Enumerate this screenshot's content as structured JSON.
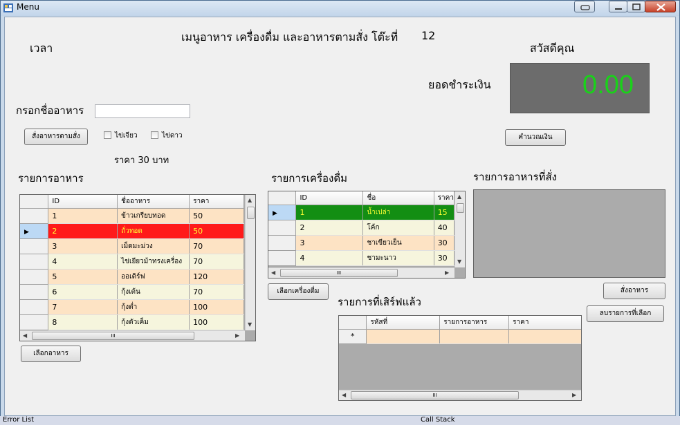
{
  "window": {
    "title": "Menu",
    "controls": [
      "minimize",
      "maximize",
      "close"
    ]
  },
  "labels": {
    "time": "เวลา",
    "header": "เมนูอาหาร เครื่องดื่ม และอาหารตามสั่ง โต๊ะที่",
    "table_number": "12",
    "greeting": "สวัสดีคุณ",
    "total_label": "ยอดชำระเงิน",
    "total_value": "0.00",
    "food_name_label": "กรอกชื่ออาหาร",
    "price_note": "ราคา 30 บาท",
    "food_list_title": "รายการอาหาร",
    "drink_list_title": "รายการเครื่องดื่ม",
    "ordered_list_title": "รายการอาหารที่สั่ง",
    "served_list_title": "รายการที่เสิร์ฟแล้ว"
  },
  "inputs": {
    "food_name_value": ""
  },
  "checkboxes": [
    {
      "label": "ไข่เจียว",
      "checked": false
    },
    {
      "label": "ไข่ดาว",
      "checked": false
    }
  ],
  "buttons": {
    "order_custom": "สั่งอาหารตามสั่ง",
    "calculate": "คำนวณเงิน",
    "select_food": "เลือกอาหาร",
    "select_drink": "เลือกเครื่องดื่ม",
    "place_order": "สั่งอาหาร",
    "delete_selected": "ลบรายการที่เลือก"
  },
  "food_grid": {
    "columns": [
      "ID",
      "ชื่ออาหาร",
      "ราคา"
    ],
    "rows": [
      {
        "id": "1",
        "name": "ข้าวเกรียบทอด",
        "price": "50"
      },
      {
        "id": "2",
        "name": "ถั่วทอด",
        "price": "50"
      },
      {
        "id": "3",
        "name": "เม็ดมะม่วง",
        "price": "70"
      },
      {
        "id": "4",
        "name": "ไข่เยียวม้าทรงเครื่อง",
        "price": "70"
      },
      {
        "id": "5",
        "name": "ออเดิร์ฟ",
        "price": "120"
      },
      {
        "id": "6",
        "name": "กุ้งเต้น",
        "price": "70"
      },
      {
        "id": "7",
        "name": "กุ้งต่ำ",
        "price": "100"
      },
      {
        "id": "8",
        "name": "กุ้งตัวเค็ม",
        "price": "100"
      }
    ],
    "selected_row": 1
  },
  "drink_grid": {
    "columns": [
      "ID",
      "ชื่อ",
      "ราคา"
    ],
    "rows": [
      {
        "id": "1",
        "name": "น้ำเปล่า",
        "price": "15"
      },
      {
        "id": "2",
        "name": "โค้ก",
        "price": "40"
      },
      {
        "id": "3",
        "name": "ชาเขียวเย็น",
        "price": "30"
      },
      {
        "id": "4",
        "name": "ชามะนาว",
        "price": "30"
      }
    ],
    "selected_row": 0
  },
  "served_grid": {
    "columns": [
      "รหัสที่",
      "รายการอาหาร",
      "ราคา"
    ],
    "new_row_marker": "*"
  },
  "scroll": {
    "ellipsis": "III"
  },
  "statusbar": {
    "left": "Error List",
    "right": "Call Stack"
  },
  "colors": {
    "row_peach": "#fde3c4",
    "row_cream": "#f6f5dd",
    "selected_red": "#ff1a1a",
    "selected_green": "#138e13",
    "selected_text": "#ffff33",
    "display_bg": "#6c6c6c",
    "display_text": "#19d219"
  }
}
